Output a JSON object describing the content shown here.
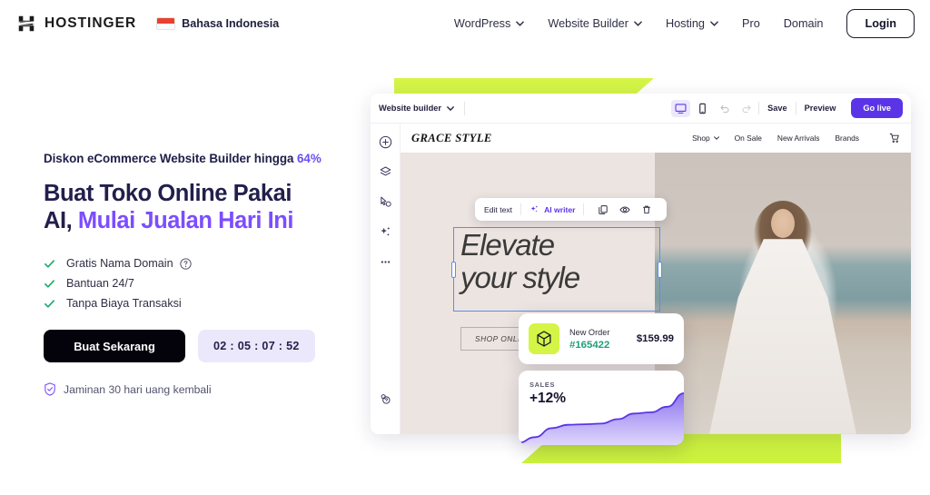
{
  "header": {
    "logo_text": "HOSTINGER",
    "logo_icon": "hostinger-logo-icon",
    "language": {
      "label": "Bahasa Indonesia",
      "flag_icon": "indonesia-flag-icon"
    },
    "nav": [
      {
        "label": "WordPress",
        "has_dropdown": true
      },
      {
        "label": "Website Builder",
        "has_dropdown": true
      },
      {
        "label": "Hosting",
        "has_dropdown": true
      },
      {
        "label": "Pro",
        "has_dropdown": false
      },
      {
        "label": "Domain",
        "has_dropdown": false
      }
    ],
    "login_label": "Login"
  },
  "hero": {
    "eyebrow_text": "Diskon eCommerce Website Builder hingga ",
    "eyebrow_percent": "64%",
    "headline_line1": "Buat Toko Online Pakai",
    "headline_line2_plain": "AI, ",
    "headline_line2_accent": "Mulai Jualan Hari Ini",
    "features": [
      {
        "label": "Gratis Nama Domain",
        "has_help": true
      },
      {
        "label": "Bantuan 24/7",
        "has_help": false
      },
      {
        "label": "Tanpa Biaya Transaksi",
        "has_help": false
      }
    ],
    "cta_label": "Buat Sekarang",
    "timer": "02 : 05 : 07 : 52",
    "guarantee": "Jaminan 30 hari uang kembali",
    "colors": {
      "accent_purple": "#7c4dff",
      "eyebrow_purple": "#6b4df6",
      "cta_bg": "#04030b",
      "timer_bg": "#ece8fc",
      "check_green": "#1faa6a",
      "lime": "#d4f546"
    }
  },
  "builder": {
    "toolbar": {
      "project_label": "Website builder",
      "desktop_icon": "desktop-icon",
      "mobile_icon": "mobile-icon",
      "undo_icon": "undo-icon",
      "redo_icon": "redo-icon",
      "save_label": "Save",
      "preview_label": "Preview",
      "golive_label": "Go live"
    },
    "rail_icons": [
      "add-circle-icon",
      "layers-icon",
      "pages-cursor-icon",
      "ai-sparkle-icon",
      "more-ellipsis-icon",
      "settings-help-icon"
    ],
    "store": {
      "logo": "GRACE STYLE",
      "nav": [
        {
          "label": "Shop",
          "has_dropdown": true
        },
        {
          "label": "On Sale",
          "has_dropdown": false
        },
        {
          "label": "New Arrivals",
          "has_dropdown": false
        },
        {
          "label": "Brands",
          "has_dropdown": false
        }
      ],
      "cart_icon": "shopping-cart-icon"
    },
    "edit_toolbar": {
      "edit_text_label": "Edit text",
      "ai_writer_label": "AI writer",
      "sparkle_icon": "sparkle-icon",
      "duplicate_icon": "duplicate-icon",
      "visibility_icon": "eye-icon",
      "delete_icon": "trash-icon"
    },
    "canvas": {
      "hero_title_line1": "Elevate",
      "hero_title_line2": "your style",
      "shop_button_label": "SHOP ONLINE",
      "photo_alt": "woman-in-white-dress-on-beach"
    },
    "order_card": {
      "title": "New Order",
      "order_number": "#165422",
      "price": "$159.99",
      "icon": "package-box-icon"
    },
    "sales_card": {
      "label": "SALES",
      "value": "+12%"
    }
  },
  "chart_data": {
    "type": "area",
    "title": "SALES",
    "annotation": "+12%",
    "x": [
      0,
      1,
      2,
      3,
      4,
      5,
      6,
      7,
      8,
      9,
      10
    ],
    "values": [
      4,
      14,
      30,
      36,
      37,
      38,
      46,
      56,
      58,
      68,
      92
    ],
    "ylim": [
      0,
      100
    ],
    "xlabel": "",
    "ylabel": "",
    "grid": false,
    "legend": false,
    "line_color": "#5b34e8",
    "fill_gradient": [
      "#8f77f0",
      "#ded6fb"
    ]
  }
}
